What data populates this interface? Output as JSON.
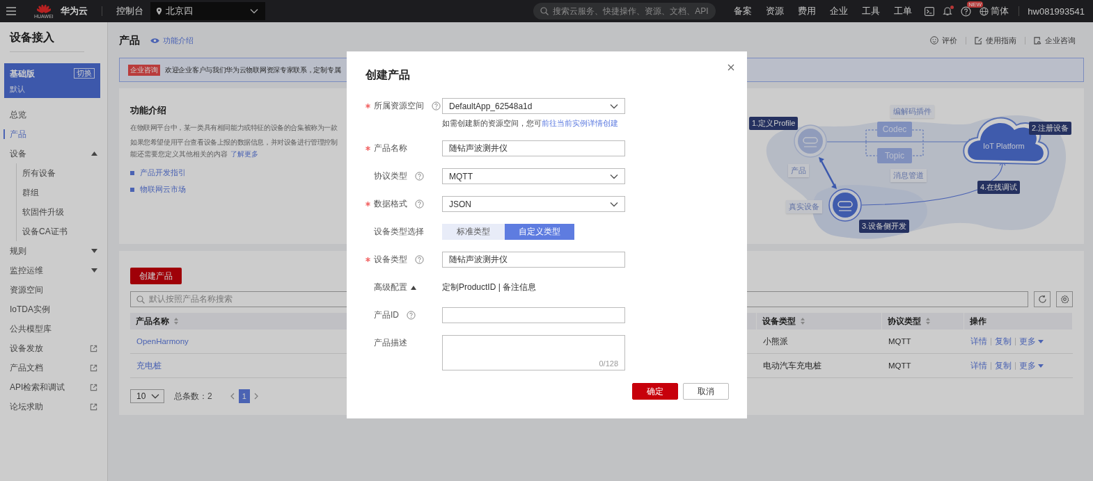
{
  "top_bar": {
    "logo_text": "HUAWEI",
    "brand": "华为云",
    "console": "控制台",
    "region": "北京四",
    "search": {
      "placeholder": "搜索云服务、快捷操作、资源、文档、API"
    },
    "links": [
      "备案",
      "资源",
      "费用",
      "企业",
      "工具",
      "工单"
    ],
    "help_badge": "NEW",
    "notifications_dot": true,
    "language": "简体",
    "user": "hw081993541"
  },
  "sidebar": {
    "title": "设备接入",
    "edition": {
      "name": "基础版",
      "switch": "切换",
      "instance": "默认"
    },
    "items": [
      {
        "label": "总览",
        "selected": false,
        "external": false
      },
      {
        "label": "产品",
        "selected": true,
        "external": false
      },
      {
        "label": "设备",
        "selected": false,
        "external": false,
        "expanded": true,
        "children": [
          {
            "label": "所有设备",
            "selected": false
          },
          {
            "label": "群组",
            "selected": false
          },
          {
            "label": "软固件升级",
            "selected": false
          },
          {
            "label": "设备CA证书",
            "selected": false
          }
        ]
      },
      {
        "label": "规则",
        "selected": false,
        "external": false,
        "expanded": false
      },
      {
        "label": "监控运维",
        "selected": false,
        "external": false,
        "expanded": false
      },
      {
        "label": "资源空间",
        "selected": false,
        "external": false
      },
      {
        "label": "IoTDA实例",
        "selected": false,
        "external": false
      },
      {
        "label": "公共模型库",
        "selected": false,
        "external": false
      },
      {
        "label": "设备发放",
        "selected": false,
        "external": true
      },
      {
        "label": "产品文档",
        "selected": false,
        "external": true
      },
      {
        "label": "API检索和调试",
        "selected": false,
        "external": true
      },
      {
        "label": "论坛求助",
        "selected": false,
        "external": true
      }
    ]
  },
  "page": {
    "title": "产品",
    "intro_link": "功能介绍",
    "header_links": [
      "评价",
      "使用指南",
      "企业咨询"
    ],
    "banner": {
      "tag": "企业咨询",
      "text": "欢迎企业客户与我们华为云物联网资深专家联系，定制专属"
    },
    "intro": {
      "title": "功能介绍",
      "lines": [
        "在物联网平台中，某一类具有相同能力或特征的设备的合集被称为一款",
        "如果您希望使用平台查看设备上报的数据信息，并对设备进行管理控制"
      ],
      "more_text": "能还需要您定义其他相关的内容",
      "more_link": "了解更多",
      "links": [
        "产品开发指引",
        "物联网云市场"
      ]
    },
    "diagram": {
      "steps": [
        "1.定义Profile",
        "2.注册设备",
        "3.设备侧开发",
        "4.在线调试"
      ],
      "tags": [
        "编解码插件",
        "消息管道",
        "产品",
        "真实设备"
      ],
      "boxes": [
        "Codec",
        "Topic"
      ],
      "platform": "IoT Platform"
    },
    "create_button": "创建产品",
    "search": {
      "placeholder": "默认按照产品名称搜索"
    },
    "table": {
      "columns": [
        {
          "label": "产品名称",
          "sortable": true
        },
        {
          "label": "设备类型",
          "sortable": true
        },
        {
          "label": "协议类型",
          "sortable": true
        },
        {
          "label": "操作",
          "sortable": false
        }
      ],
      "rows": [
        {
          "name": "OpenHarmony",
          "device_type": "小熊派",
          "protocol": "MQTT",
          "actions": [
            "详情",
            "复制",
            "更多"
          ]
        },
        {
          "name": "充电桩",
          "device_type": "电动汽车充电桩",
          "protocol": "MQTT",
          "actions": [
            "详情",
            "复制",
            "更多"
          ]
        }
      ]
    },
    "pagination": {
      "page_size": "10",
      "total": "总条数：2",
      "pages": [
        {
          "label": "1",
          "selected": true
        }
      ]
    }
  },
  "dialog": {
    "title": "创建产品",
    "fields": [
      {
        "kind": "select",
        "label": "所属资源空间",
        "required": true,
        "help": true,
        "value": "DefaultApp_62548a1d",
        "hint": "如需创建新的资源空间，您可",
        "hint_link": "前往当前实例详情创建"
      },
      {
        "kind": "input",
        "label": "产品名称",
        "required": true,
        "help": false,
        "value": "随钻声波测井仪"
      },
      {
        "kind": "select",
        "label": "协议类型",
        "required": false,
        "help": true,
        "value": "MQTT"
      },
      {
        "kind": "select",
        "label": "数据格式",
        "required": true,
        "help": true,
        "value": "JSON"
      },
      {
        "kind": "segmented",
        "label": "设备类型选择",
        "required": false,
        "help": false,
        "options": [
          {
            "label": "标准类型",
            "selected": false
          },
          {
            "label": "自定义类型",
            "selected": true
          }
        ]
      },
      {
        "kind": "input",
        "label": "设备类型",
        "required": true,
        "help": true,
        "value": "随钻声波测井仪"
      },
      {
        "kind": "toggle",
        "label": "高级配置",
        "required": false,
        "help": false,
        "expanded": true,
        "value": "定制ProductID | 备注信息"
      },
      {
        "kind": "input",
        "label": "产品ID",
        "required": false,
        "help": true
      },
      {
        "kind": "textarea",
        "label": "产品描述",
        "required": false,
        "help": false,
        "counter": "0/128"
      }
    ],
    "buttons": [
      {
        "label": "确定",
        "primary": true
      },
      {
        "label": "取消",
        "primary": false
      }
    ]
  }
}
